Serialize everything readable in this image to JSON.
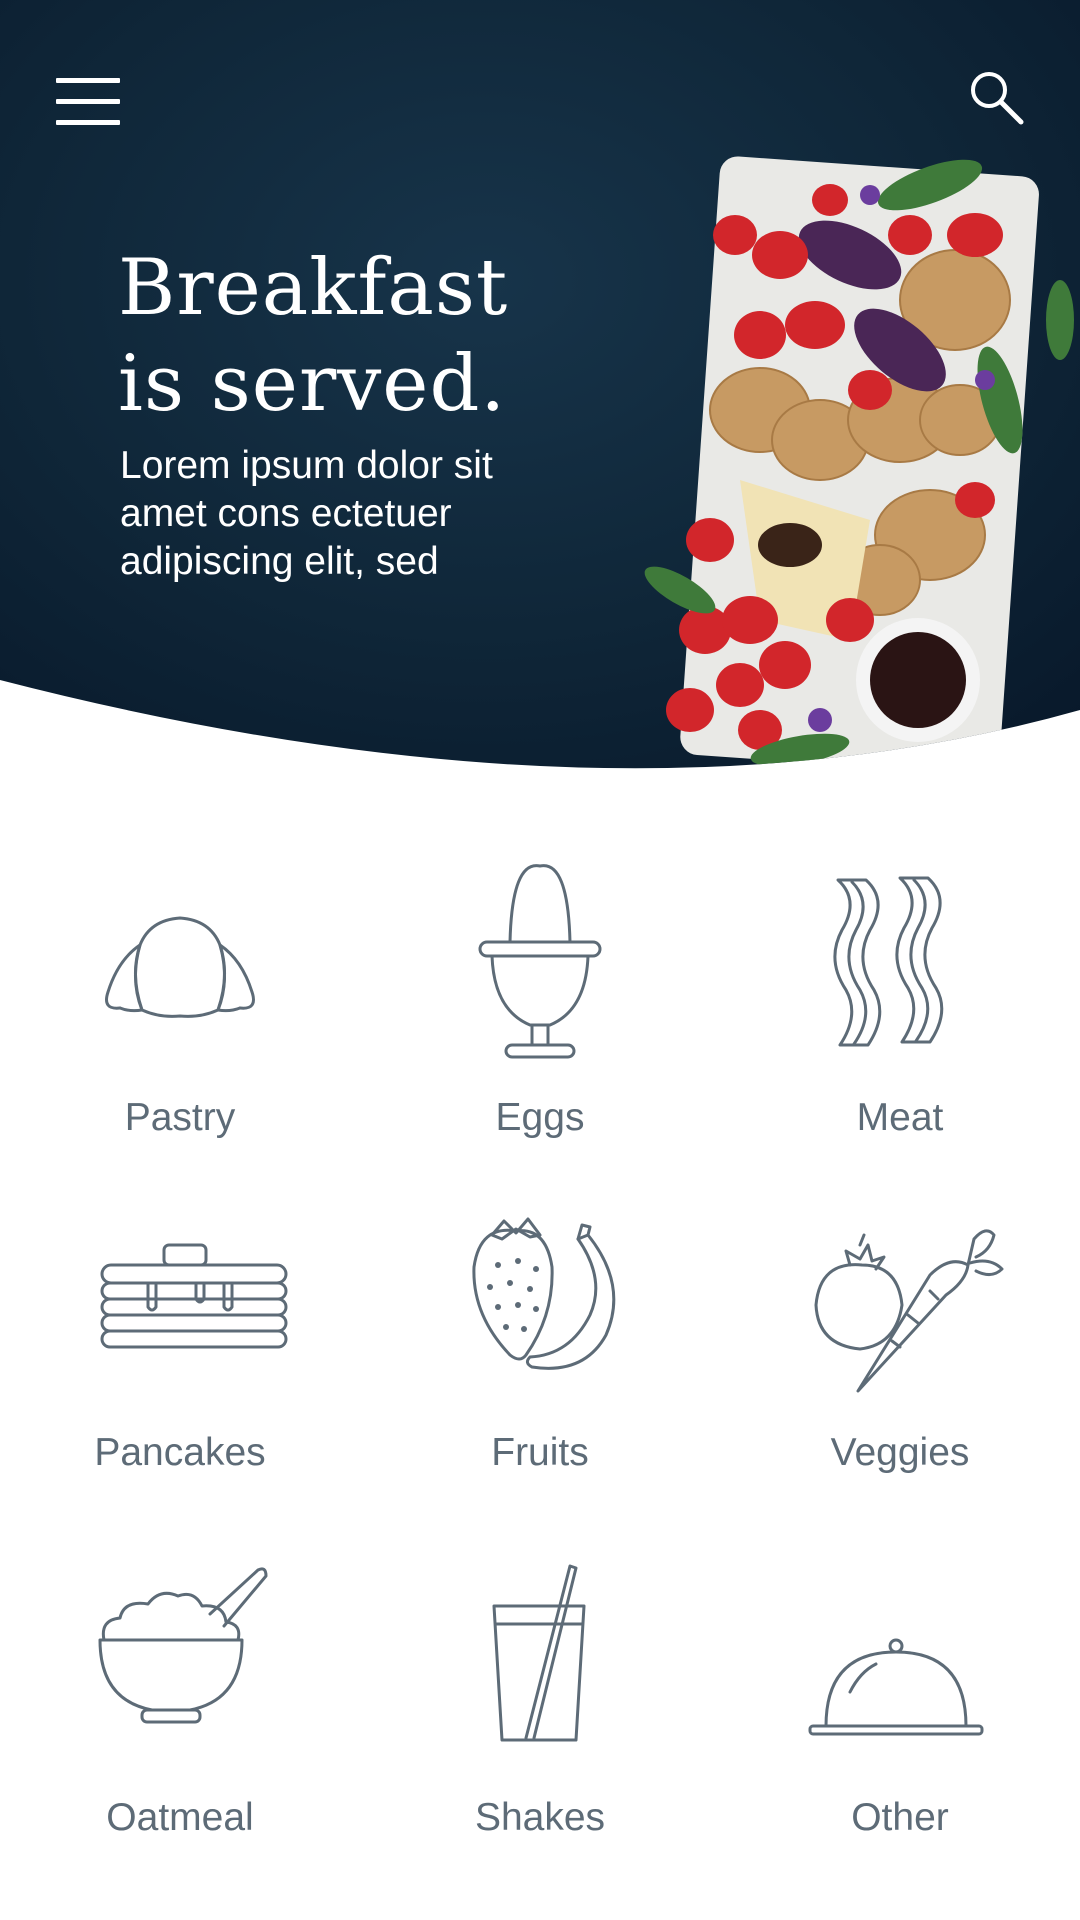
{
  "hero": {
    "title": "Breakfast\nis served.",
    "subtitle": "Lorem ipsum dolor sit amet cons ectetuer adipiscing elit, sed",
    "background_color": "#0e2233"
  },
  "toolbar": {
    "menu_icon": "hamburger-menu-icon",
    "search_icon": "search-icon"
  },
  "categories": [
    {
      "label": "Pastry",
      "icon": "croissant-icon"
    },
    {
      "label": "Eggs",
      "icon": "egg-cup-icon"
    },
    {
      "label": "Meat",
      "icon": "bacon-icon"
    },
    {
      "label": "Pancakes",
      "icon": "pancakes-icon"
    },
    {
      "label": "Fruits",
      "icon": "strawberry-banana-icon"
    },
    {
      "label": "Veggies",
      "icon": "tomato-carrot-icon"
    },
    {
      "label": "Oatmeal",
      "icon": "bowl-icon"
    },
    {
      "label": "Shakes",
      "icon": "glass-straw-icon"
    },
    {
      "label": "Other",
      "icon": "cloche-icon"
    }
  ],
  "colors": {
    "icon_stroke": "#5d6b77",
    "label_text": "#5d6b77",
    "hero_text": "#ffffff"
  }
}
